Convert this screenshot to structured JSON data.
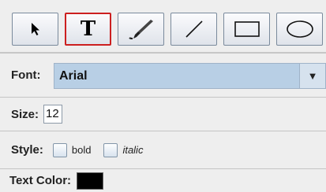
{
  "toolbar": {
    "tools": [
      {
        "icon": "arrow-pointer-icon",
        "selected": false
      },
      {
        "icon": "text-tool-icon",
        "glyph": "T",
        "selected": true
      },
      {
        "icon": "brush-icon",
        "selected": false
      },
      {
        "icon": "line-icon",
        "selected": false
      },
      {
        "icon": "rectangle-icon",
        "selected": false
      },
      {
        "icon": "ellipse-icon",
        "selected": false
      }
    ],
    "selected_border_color": "#cc1f1f"
  },
  "font": {
    "label": "Font:",
    "value": "Arial",
    "dropdown_arrow": "▼"
  },
  "size": {
    "label": "Size:",
    "value": "12"
  },
  "style": {
    "label": "Style:",
    "bold_label": "bold",
    "italic_label": "italic",
    "bold_checked": false,
    "italic_checked": false
  },
  "text_color": {
    "label": "Text Color:",
    "color": "#000000"
  }
}
